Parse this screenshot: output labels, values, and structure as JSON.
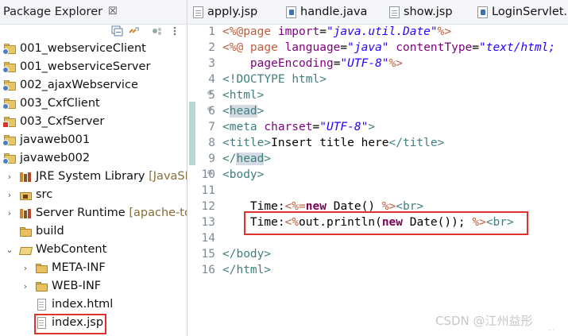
{
  "explorer": {
    "title": "Package Explorer",
    "close_glyph": "☒",
    "items": [
      {
        "label": "001_webserviceClient",
        "icon": "project-icon",
        "twisty": ""
      },
      {
        "label": "001_webserviceServer",
        "icon": "project-icon",
        "twisty": ""
      },
      {
        "label": "002_ajaxWebservice",
        "icon": "project-icon",
        "twisty": ""
      },
      {
        "label": "003_CxfClient",
        "icon": "project-icon",
        "twisty": ""
      },
      {
        "label": "003_CxfServer",
        "icon": "project-error-icon",
        "twisty": ""
      },
      {
        "label": "javaweb001",
        "icon": "project-icon",
        "twisty": ""
      },
      {
        "label": "javaweb002",
        "icon": "project-icon",
        "twisty": ""
      },
      {
        "label": "JRE System Library",
        "suffix": "[JavaSE",
        "icon": "library-icon",
        "twisty": "›"
      },
      {
        "label": "src",
        "icon": "source-folder-icon",
        "twisty": "›"
      },
      {
        "label": "Server Runtime",
        "suffix": "[apache-to",
        "icon": "library-icon",
        "twisty": "›"
      },
      {
        "label": "build",
        "icon": "folder-icon",
        "twisty": ""
      },
      {
        "label": "WebContent",
        "icon": "open-folder-icon",
        "twisty": "⌄"
      },
      {
        "label": "META-INF",
        "icon": "folder-icon",
        "twisty": "›"
      },
      {
        "label": "WEB-INF",
        "icon": "folder-icon",
        "twisty": "›"
      },
      {
        "label": "index.html",
        "icon": "file-icon",
        "twisty": ""
      },
      {
        "label": "index.jsp",
        "icon": "file-icon",
        "twisty": ""
      }
    ]
  },
  "editor": {
    "tabs": [
      {
        "label": "apply.jsp",
        "icon": "jsp-file-icon"
      },
      {
        "label": "handle.java",
        "icon": "java-file-icon"
      },
      {
        "label": "show.jsp",
        "icon": "jsp-file-icon"
      },
      {
        "label": "LoginServlet.",
        "icon": "java-file-icon"
      }
    ],
    "lines": [
      {
        "n": "1",
        "fold": ""
      },
      {
        "n": "2",
        "fold": ""
      },
      {
        "n": "3",
        "fold": ""
      },
      {
        "n": "4",
        "fold": ""
      },
      {
        "n": "5",
        "fold": "⊖"
      },
      {
        "n": "6",
        "fold": "⊖"
      },
      {
        "n": "7",
        "fold": ""
      },
      {
        "n": "8",
        "fold": ""
      },
      {
        "n": "9",
        "fold": ""
      },
      {
        "n": "10",
        "fold": "⊖"
      },
      {
        "n": "11",
        "fold": ""
      },
      {
        "n": "12",
        "fold": ""
      },
      {
        "n": "13",
        "fold": ""
      },
      {
        "n": "14",
        "fold": ""
      },
      {
        "n": "15",
        "fold": ""
      },
      {
        "n": "16",
        "fold": ""
      }
    ],
    "code": {
      "l1_a": "<%@page ",
      "l1_b": "import",
      "l1_c": "=",
      "l1_d": "\"java.util.Date\"",
      "l1_e": "%>",
      "l2_a": "<%@ page ",
      "l2_b": "language",
      "l2_c": "=",
      "l2_d": "\"java\"",
      "l2_e": " contentType",
      "l2_f": "=",
      "l2_g": "\"text/html;",
      "l3_a": "    pageEncoding",
      "l3_b": "=",
      "l3_c": "\"UTF-8\"",
      "l3_d": "%>",
      "l4_a": "<!DOCTYPE ",
      "l4_b": "html",
      "l4_c": ">",
      "l5": "<html>",
      "l6_a": "<",
      "l6_b": "head",
      "l6_c": ">",
      "l7_a": "<meta ",
      "l7_b": "charset",
      "l7_c": "=",
      "l7_d": "\"UTF-8\"",
      "l7_e": ">",
      "l8_a": "<title>",
      "l8_b": "Insert title here",
      "l8_c": "</title>",
      "l9_a": "</",
      "l9_b": "head",
      "l9_c": ">",
      "l10": "<body>",
      "l12_a": "    Time:",
      "l12_b": "<%=",
      "l12_c": "new",
      "l12_d": " Date() ",
      "l12_e": "%>",
      "l12_f": "<br>",
      "l13_a": "    Time:",
      "l13_b": "<%",
      "l13_c": "out.println(",
      "l13_d": "new",
      "l13_e": " Date()); ",
      "l13_f": "%>",
      "l13_g": "<br>",
      "l15": "</body>",
      "l16": "</html>"
    }
  },
  "watermark": {
    "text": "CSDN @江州益彤",
    "sub": "..."
  },
  "colors": {
    "highlight_box": "#e0322d",
    "keyword": "#7f0055",
    "tag": "#3f7f7f",
    "string": "#2a00ff"
  }
}
